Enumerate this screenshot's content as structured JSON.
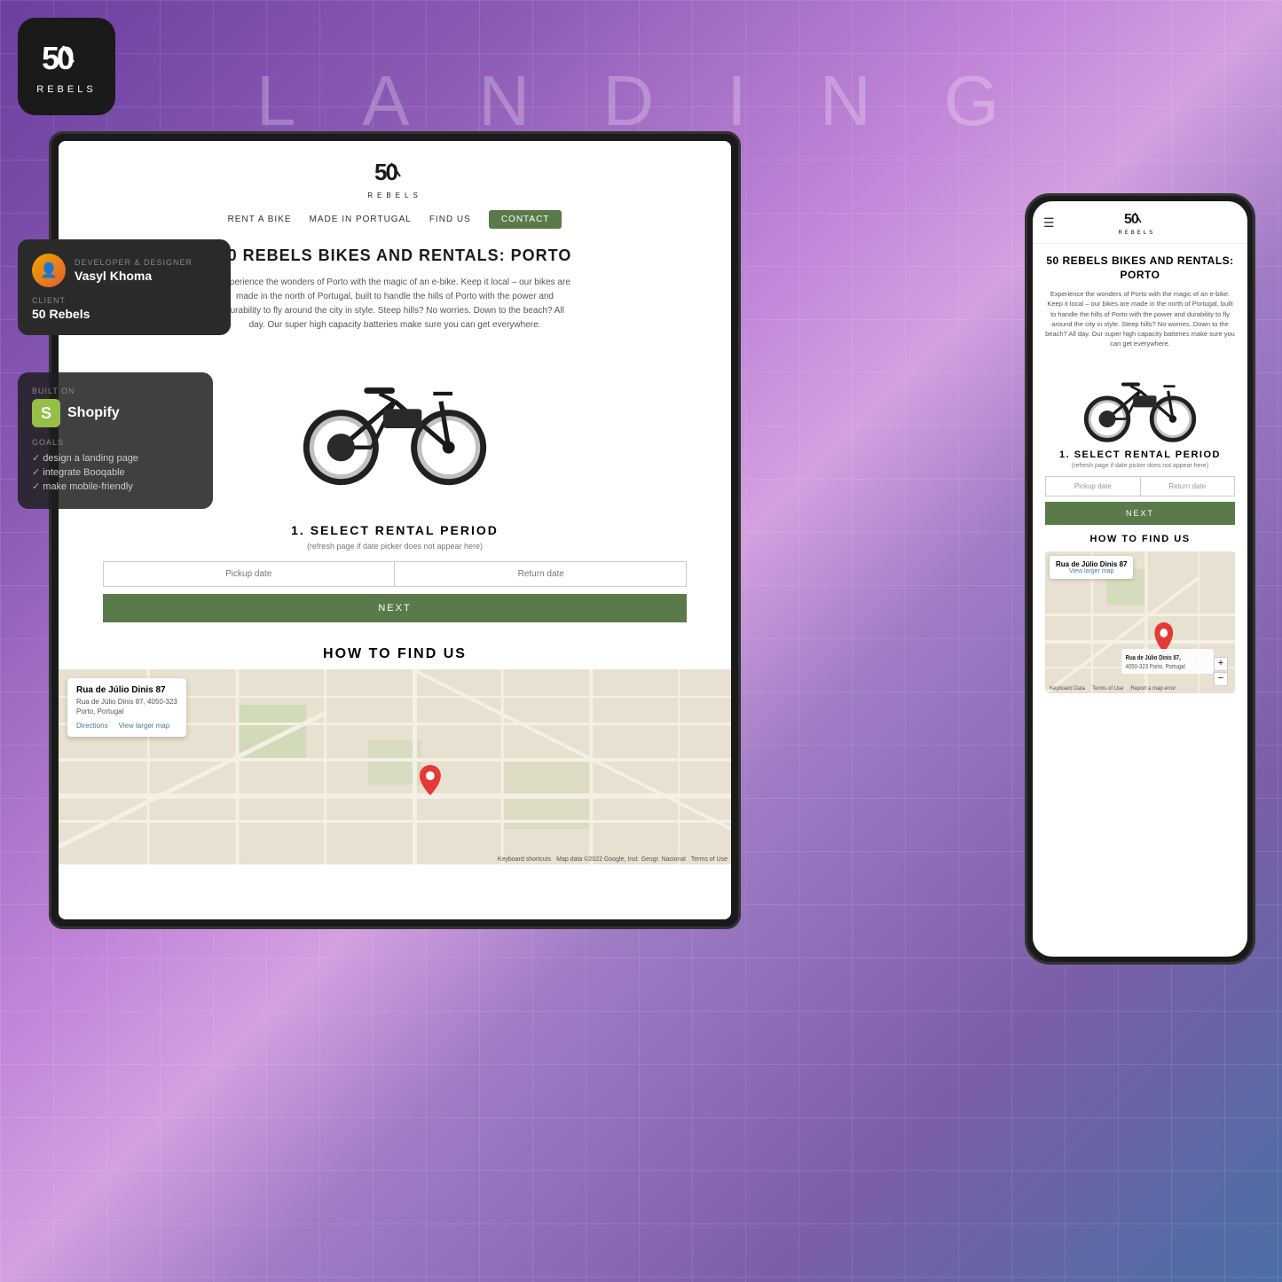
{
  "background": {
    "landing_label": "L A N D I N G"
  },
  "top_logo": {
    "icon": "50",
    "text": "REBELS"
  },
  "dev_card": {
    "role_label": "DEVELOPER & DESIGNER",
    "name": "Vasyl Khoma",
    "client_label": "CLIENT",
    "client_name": "50 Rebels"
  },
  "builton_card": {
    "label": "BUILT ON",
    "platform": "Shopify",
    "goals_label": "GOALS",
    "goals": [
      "design a landing page",
      "integrate Booqable",
      "make  mobile-friendly"
    ]
  },
  "site": {
    "logo_icon": "50",
    "logo_text": "REBELS",
    "nav": {
      "items": [
        "RENT A BIKE",
        "MADE IN PORTUGAL",
        "FIND US"
      ],
      "contact": "CONTACT"
    },
    "hero_title": "50 REBELS BIKES AND RENTALS: PORTO",
    "hero_description": "Experience the wonders of Porto with the magic of an e-bike. Keep it local – our bikes are made in the north of Portugal, built to handle the hills of Porto with the power and durability to fly around the city in style. Steep hills? No worries. Down to the beach? All day. Our super high capacity batteries make sure you can get everywhere.",
    "rental_section": {
      "title": "1. SELECT RENTAL PERIOD",
      "subtitle": "(refresh page if date picker does not appear here)",
      "pickup_placeholder": "Pickup date",
      "return_placeholder": "Return date",
      "next_button": "NEXT"
    },
    "how_to_find": "HOW TO FIND US",
    "map": {
      "popup_title": "Rua de Júlio Dinis 87",
      "popup_address": "Rua de Júlio Dinis 87, 4050-323\nPorto, Portugal",
      "popup_link1": "Directions",
      "popup_link2": "View larger map",
      "attribution": "Map data ©2022 Google, Inst. Geogr. Nacional",
      "keyboard_shortcuts": "Keyboard shortcuts",
      "terms": "Terms of Use"
    }
  },
  "mobile": {
    "logo_icon": "50",
    "logo_text": "REBELS",
    "hero_title": "50 REBELS BIKES AND RENTALS: PORTO",
    "hero_description": "Experience the wonders of Porto with the magic of an e-bike. Keep it local – our bikes are made in the north of Portugal, built to handle the hills of Porto with the power and durability to fly around the city in style. Steep hills? No worries. Down to the beach? All day. Our super high capacity batteries make sure you can get everywhere.",
    "rental_title": "1. SELECT RENTAL PERIOD",
    "rental_sub": "(refresh page if date picker does not appear here)",
    "pickup_placeholder": "Pickup date",
    "return_placeholder": "Return date",
    "next_button": "NEXT",
    "how_find": "HOW TO FIND US",
    "map_popup_title": "Rua de Júlio Dinis 87",
    "map_popup_link": "View larger map",
    "map_address": "Rua de Júlio Dinis 87,\n4050-323 Porto, Portugal",
    "map_footer": [
      "Keyboard Data",
      "Terms of Use",
      "Report a map error"
    ]
  }
}
